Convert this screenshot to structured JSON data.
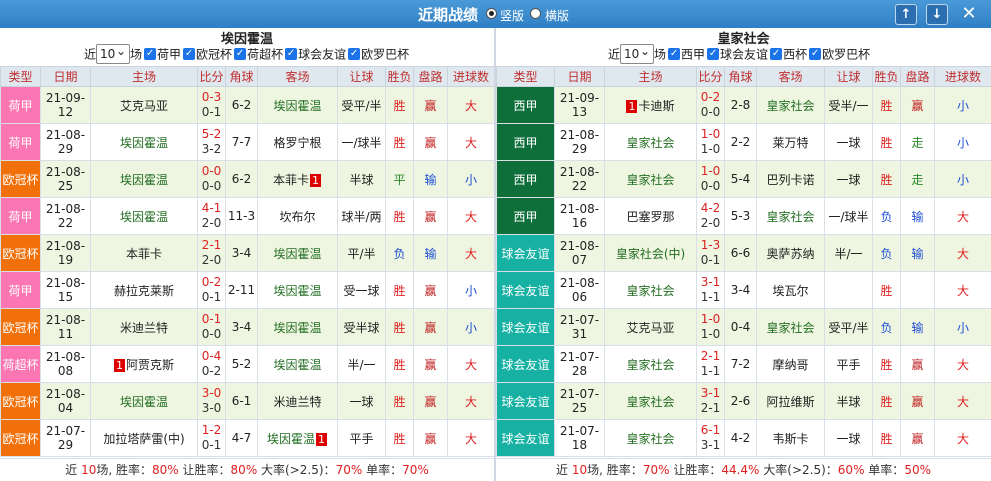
{
  "header": {
    "title": "近期战绩",
    "vertical_label": "竖版",
    "horizontal_label": "横版",
    "up_icon": "↑",
    "down_icon": "↓",
    "close_icon": "✕"
  },
  "league_colors": {
    "荷甲": "#fb76b2",
    "欧冠杯": "#f2700a",
    "荷超杯": "#fb76b2",
    "西甲": "#0e6f3a",
    "球会友谊": "#16b1a3"
  },
  "columns": [
    "类型",
    "日期",
    "主场",
    "比分",
    "角球",
    "客场",
    "让球",
    "胜负",
    "盘路",
    "进球数"
  ],
  "left": {
    "team": "埃因霍温",
    "recent_prefix": "近",
    "recent_count": "10",
    "recent_suffix": "场",
    "filters": [
      "荷甲",
      "欧冠杯",
      "荷超杯",
      "球会友谊",
      "欧罗巴杯"
    ],
    "rows": [
      {
        "league": "荷甲",
        "date": "21-09-12",
        "home": "艾克马亚",
        "home_rc": "",
        "ft": "0-3",
        "ht": "0-1",
        "corner": "6-2",
        "away": "埃因霍温",
        "away_rc": "",
        "hcap": "受平/半",
        "result": "胜",
        "pan": "赢",
        "ou": "大",
        "team_side": "away"
      },
      {
        "league": "荷甲",
        "date": "21-08-29",
        "home": "埃因霍温",
        "home_rc": "",
        "ft": "5-2",
        "ht": "3-2",
        "corner": "7-7",
        "away": "格罗宁根",
        "away_rc": "",
        "hcap": "一/球半",
        "result": "胜",
        "pan": "赢",
        "ou": "大",
        "team_side": "home"
      },
      {
        "league": "欧冠杯",
        "date": "21-08-25",
        "home": "埃因霍温",
        "home_rc": "",
        "ft": "0-0",
        "ht": "0-0",
        "corner": "6-2",
        "away": "本菲卡",
        "away_rc": "1",
        "hcap": "半球",
        "result": "平",
        "pan": "输",
        "ou": "小",
        "team_side": "home"
      },
      {
        "league": "荷甲",
        "date": "21-08-22",
        "home": "埃因霍温",
        "home_rc": "",
        "ft": "4-1",
        "ht": "2-0",
        "corner": "11-3",
        "away": "坎布尔",
        "away_rc": "",
        "hcap": "球半/两",
        "result": "胜",
        "pan": "赢",
        "ou": "大",
        "team_side": "home"
      },
      {
        "league": "欧冠杯",
        "date": "21-08-19",
        "home": "本菲卡",
        "home_rc": "",
        "ft": "2-1",
        "ht": "2-0",
        "corner": "3-4",
        "away": "埃因霍温",
        "away_rc": "",
        "hcap": "平/半",
        "result": "负",
        "pan": "输",
        "ou": "大",
        "team_side": "away"
      },
      {
        "league": "荷甲",
        "date": "21-08-15",
        "home": "赫拉克莱斯",
        "home_rc": "",
        "ft": "0-2",
        "ht": "0-1",
        "corner": "2-11",
        "away": "埃因霍温",
        "away_rc": "",
        "hcap": "受一球",
        "result": "胜",
        "pan": "赢",
        "ou": "小",
        "team_side": "away"
      },
      {
        "league": "欧冠杯",
        "date": "21-08-11",
        "home": "米迪兰特",
        "home_rc": "",
        "ft": "0-1",
        "ht": "0-0",
        "corner": "3-4",
        "away": "埃因霍温",
        "away_rc": "",
        "hcap": "受半球",
        "result": "胜",
        "pan": "赢",
        "ou": "小",
        "team_side": "away"
      },
      {
        "league": "荷超杯",
        "date": "21-08-08",
        "home": "阿贾克斯",
        "home_rc": "1",
        "ft": "0-4",
        "ht": "0-2",
        "corner": "5-2",
        "away": "埃因霍温",
        "away_rc": "",
        "hcap": "半/一",
        "result": "胜",
        "pan": "赢",
        "ou": "大",
        "team_side": "away"
      },
      {
        "league": "欧冠杯",
        "date": "21-08-04",
        "home": "埃因霍温",
        "home_rc": "",
        "ft": "3-0",
        "ht": "3-0",
        "corner": "6-1",
        "away": "米迪兰特",
        "away_rc": "",
        "hcap": "一球",
        "result": "胜",
        "pan": "赢",
        "ou": "大",
        "team_side": "home"
      },
      {
        "league": "欧冠杯",
        "date": "21-07-29",
        "home": "加拉塔萨雷(中)",
        "home_rc": "",
        "ft": "1-2",
        "ht": "0-1",
        "corner": "4-7",
        "away": "埃因霍温",
        "away_rc": "1",
        "hcap": "平手",
        "result": "胜",
        "pan": "赢",
        "ou": "大",
        "team_side": "away"
      }
    ],
    "summary": {
      "prefix": "近",
      "count": "10",
      "count_unit": "场,",
      "win_label": "胜率：",
      "win": "80%",
      "hcap_label": "让胜率：",
      "hcap": "80%",
      "big_label": "大率(>2.5)：",
      "big": "70%",
      "odd_label": "单率：",
      "odd": "70%"
    }
  },
  "right": {
    "team": "皇家社会",
    "recent_prefix": "近",
    "recent_count": "10",
    "recent_suffix": "场",
    "filters": [
      "西甲",
      "球会友谊",
      "西杯",
      "欧罗巴杯"
    ],
    "rows": [
      {
        "league": "西甲",
        "date": "21-09-13",
        "home": "卡迪斯",
        "home_rc": "1",
        "ft": "0-2",
        "ht": "0-0",
        "corner": "2-8",
        "away": "皇家社会",
        "away_rc": "",
        "hcap": "受半/一",
        "result": "胜",
        "pan": "赢",
        "ou": "小",
        "team_side": "away"
      },
      {
        "league": "西甲",
        "date": "21-08-29",
        "home": "皇家社会",
        "home_rc": "",
        "ft": "1-0",
        "ht": "1-0",
        "corner": "2-2",
        "away": "莱万特",
        "away_rc": "",
        "hcap": "一球",
        "result": "胜",
        "pan": "走",
        "ou": "小",
        "team_side": "home"
      },
      {
        "league": "西甲",
        "date": "21-08-22",
        "home": "皇家社会",
        "home_rc": "",
        "ft": "1-0",
        "ht": "0-0",
        "corner": "5-4",
        "away": "巴列卡诺",
        "away_rc": "",
        "hcap": "一球",
        "result": "胜",
        "pan": "走",
        "ou": "小",
        "team_side": "home"
      },
      {
        "league": "西甲",
        "date": "21-08-16",
        "home": "巴塞罗那",
        "home_rc": "",
        "ft": "4-2",
        "ht": "2-0",
        "corner": "5-3",
        "away": "皇家社会",
        "away_rc": "",
        "hcap": "一/球半",
        "result": "负",
        "pan": "输",
        "ou": "大",
        "team_side": "away"
      },
      {
        "league": "球会友谊",
        "date": "21-08-07",
        "home": "皇家社会(中)",
        "home_rc": "",
        "ft": "1-3",
        "ht": "0-1",
        "corner": "6-6",
        "away": "奥萨苏纳",
        "away_rc": "",
        "hcap": "半/一",
        "result": "负",
        "pan": "输",
        "ou": "大",
        "team_side": "home"
      },
      {
        "league": "球会友谊",
        "date": "21-08-06",
        "home": "皇家社会",
        "home_rc": "",
        "ft": "3-1",
        "ht": "1-1",
        "corner": "3-4",
        "away": "埃瓦尔",
        "away_rc": "",
        "hcap": "",
        "result": "胜",
        "pan": "",
        "ou": "大",
        "team_side": "home"
      },
      {
        "league": "球会友谊",
        "date": "21-07-31",
        "home": "艾克马亚",
        "home_rc": "",
        "ft": "1-0",
        "ht": "1-0",
        "corner": "0-4",
        "away": "皇家社会",
        "away_rc": "",
        "hcap": "受平/半",
        "result": "负",
        "pan": "输",
        "ou": "小",
        "team_side": "away"
      },
      {
        "league": "球会友谊",
        "date": "21-07-28",
        "home": "皇家社会",
        "home_rc": "",
        "ft": "2-1",
        "ht": "1-1",
        "corner": "7-2",
        "away": "摩纳哥",
        "away_rc": "",
        "hcap": "平手",
        "result": "胜",
        "pan": "赢",
        "ou": "大",
        "team_side": "home"
      },
      {
        "league": "球会友谊",
        "date": "21-07-25",
        "home": "皇家社会",
        "home_rc": "",
        "ft": "3-1",
        "ht": "2-1",
        "corner": "2-6",
        "away": "阿拉维斯",
        "away_rc": "",
        "hcap": "半球",
        "result": "胜",
        "pan": "赢",
        "ou": "大",
        "team_side": "home"
      },
      {
        "league": "球会友谊",
        "date": "21-07-18",
        "home": "皇家社会",
        "home_rc": "",
        "ft": "6-1",
        "ht": "3-1",
        "corner": "4-2",
        "away": "韦斯卡",
        "away_rc": "",
        "hcap": "一球",
        "result": "胜",
        "pan": "赢",
        "ou": "大",
        "team_side": "home"
      }
    ],
    "summary": {
      "prefix": "近",
      "count": "10",
      "count_unit": "场,",
      "win_label": "胜率：",
      "win": "70%",
      "hcap_label": "让胜率：",
      "hcap": "44.4%",
      "big_label": "大率(>2.5)：",
      "big": "60%",
      "odd_label": "单率：",
      "odd": "50%"
    }
  }
}
